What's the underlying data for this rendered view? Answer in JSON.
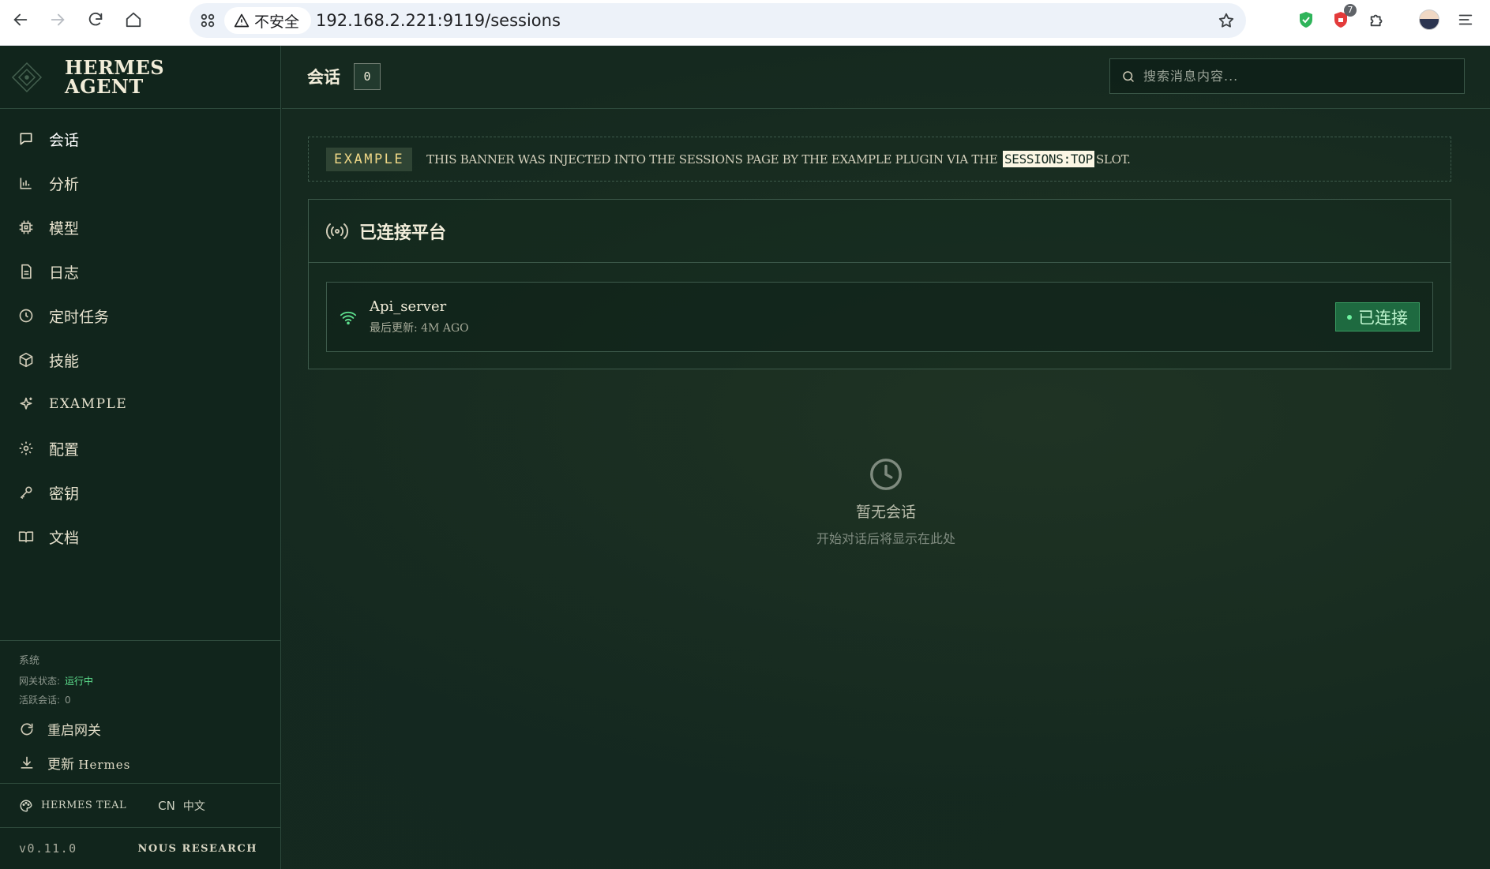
{
  "browser": {
    "security_label": "不安全",
    "url": "192.168.2.221:9119/sessions",
    "extension_badge": "7"
  },
  "brand": {
    "line1": "HERMES",
    "line2": "AGENT"
  },
  "nav": {
    "items": [
      {
        "label": "会话",
        "icon": "chat-icon"
      },
      {
        "label": "分析",
        "icon": "bar-chart-icon"
      },
      {
        "label": "模型",
        "icon": "cpu-icon"
      },
      {
        "label": "日志",
        "icon": "document-icon"
      },
      {
        "label": "定时任务",
        "icon": "clock-icon"
      },
      {
        "label": "技能",
        "icon": "package-icon"
      },
      {
        "label": "EXAMPLE",
        "icon": "sparkle-icon"
      },
      {
        "label": "配置",
        "icon": "gear-icon"
      },
      {
        "label": "密钥",
        "icon": "key-icon"
      },
      {
        "label": "文档",
        "icon": "book-icon"
      }
    ]
  },
  "system": {
    "caption": "系统",
    "gateway_label": "网关状态:",
    "gateway_value": "运行中",
    "sessions_label": "活跃会话:",
    "sessions_value": "0",
    "restart_label": "重启网关",
    "update_prefix": "更新",
    "update_name": "Hermes"
  },
  "footer": {
    "theme": "HERMES TEAL",
    "lang_code": "CN",
    "lang_name": "中文",
    "version": "v0.11.0",
    "org": "NOUS RESEARCH"
  },
  "header": {
    "title": "会话",
    "count": "0",
    "search_placeholder": "搜索消息内容..."
  },
  "banner": {
    "tag": "EXAMPLE",
    "text_before": "THIS BANNER WAS INJECTED INTO THE SESSIONS PAGE BY THE EXAMPLE PLUGIN VIA THE",
    "code": "SESSIONS:TOP",
    "text_after": "SLOT."
  },
  "platforms": {
    "title": "已连接平台",
    "items": [
      {
        "name": "Api_server",
        "updated": "最后更新: 4M AGO",
        "status": "已连接"
      }
    ]
  },
  "empty_state": {
    "title": "暂无会话",
    "subtitle": "开始对话后将显示在此处"
  },
  "colors": {
    "background": "#15291f",
    "accent_green": "#5ee08e",
    "banner_tag": "#f0d887"
  }
}
